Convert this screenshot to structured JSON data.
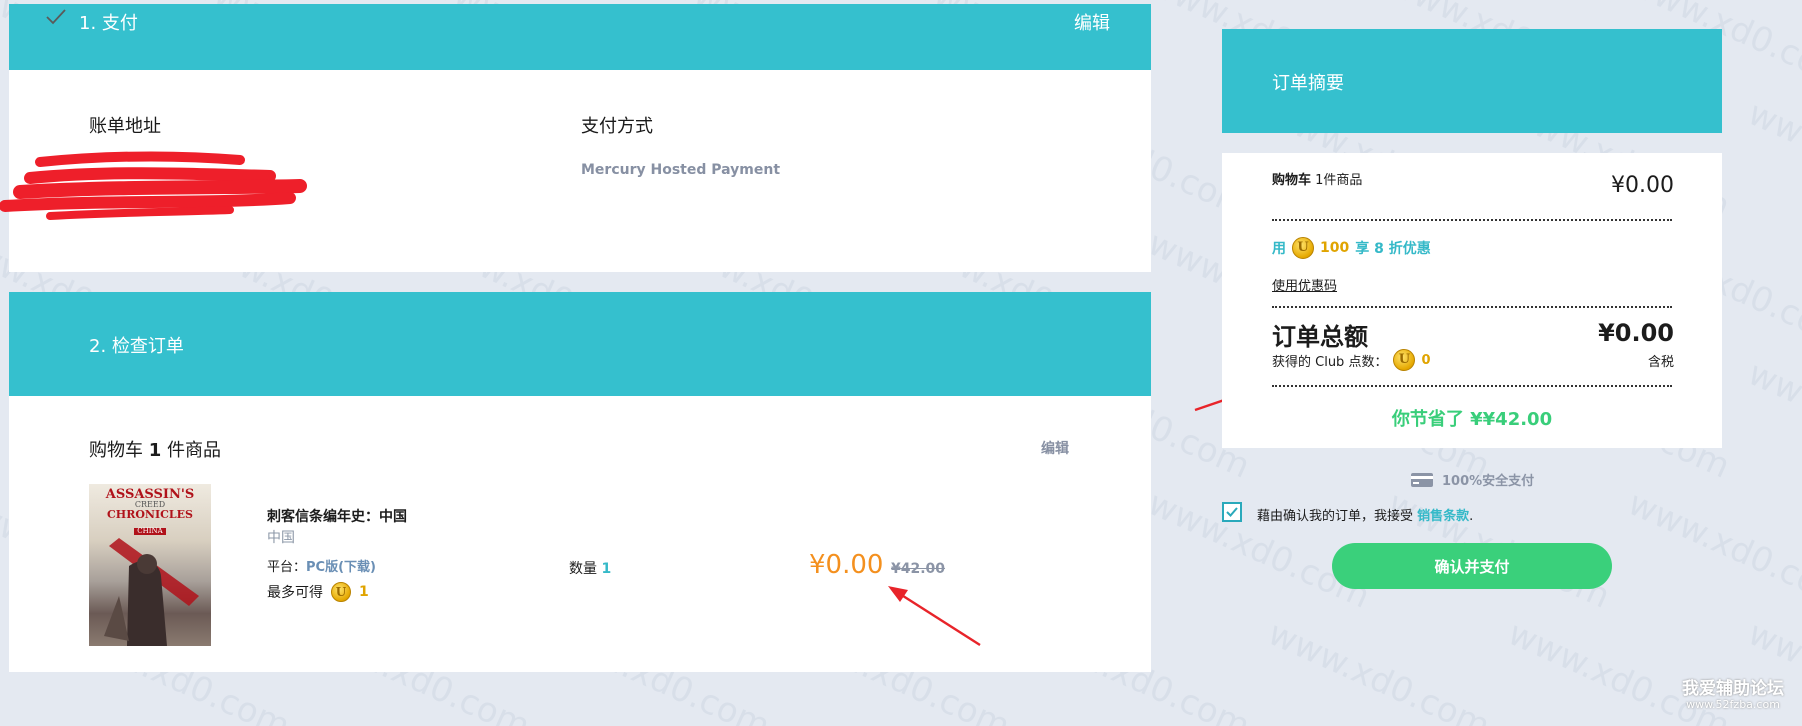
{
  "section1": {
    "header_title": "1. 支付",
    "edit_label": "编辑",
    "billing_label": "账单地址",
    "payment_method_label": "支付方式",
    "payment_method_value": "Mercury Hosted Payment"
  },
  "section2": {
    "header_title": "2. 检查订单",
    "cart_prefix": "购物车",
    "cart_count": "1",
    "cart_suffix": "件商品",
    "edit_label": "编辑",
    "item": {
      "cover_line1": "ASSASSIN'S",
      "cover_line2": "CREED",
      "cover_line3": "CHRONICLES",
      "cover_line4": "CHINA",
      "title": "刺客信条编年史：中国",
      "region": "中国",
      "platform_label": "平台：",
      "platform_value": "PC版(下载)",
      "max_earn_label": "最多可得",
      "max_earn_value": "1",
      "qty_label": "数量",
      "qty_value": "1",
      "price": "¥0.00",
      "original_price": "¥42.00"
    }
  },
  "summary": {
    "header_title": "订单摘要",
    "cart_label": "购物车",
    "cart_count_text": "1件商品",
    "cart_total": "¥0.00",
    "promo_use": "用",
    "promo_points": "100",
    "promo_text": "享 8 折优惠",
    "coupon_link": "使用优惠码",
    "order_total_label": "订单总额",
    "order_total_value": "¥0.00",
    "club_points_label": "获得的 Club 点数：",
    "club_points_value": "0",
    "tax_label": "含税",
    "savings_text": "你节省了 ¥¥42.00"
  },
  "secure_payment": "100%安全支付",
  "terms": {
    "prefix": "藉由确认我的订单，我接受",
    "link": "销售条款",
    "suffix": "."
  },
  "confirm_button": "确认并支付",
  "site_watermark_line1": "我爱辅助论坛",
  "site_watermark_line2": "www.52fzba.com",
  "bg_watermark": "www.xd0.com",
  "colors": {
    "teal": "#35c0ce",
    "green": "#39ce7a",
    "orange": "#f4901e",
    "page_bg": "#e4e9f1"
  }
}
